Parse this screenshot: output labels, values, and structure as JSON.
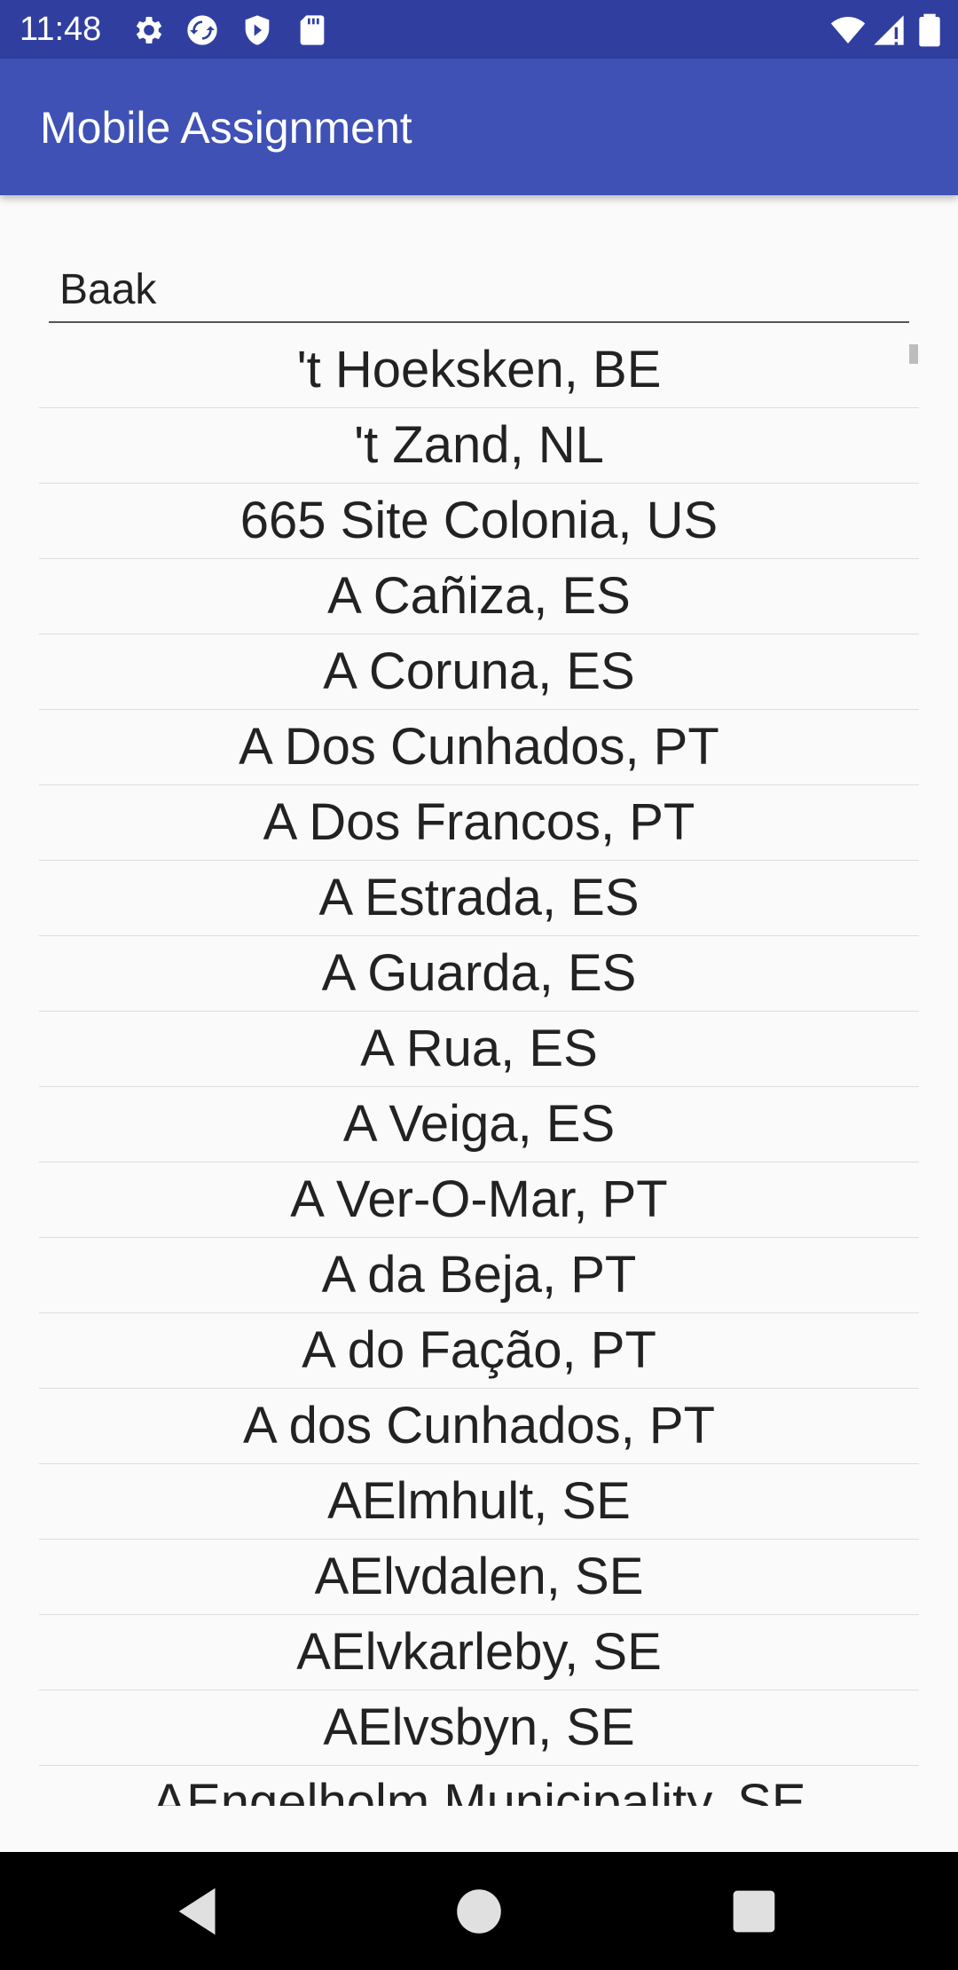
{
  "status_bar": {
    "time": "11:48",
    "icons": [
      "gear-icon",
      "sync-icon",
      "shield-icon",
      "sd-card-icon",
      "wifi-icon",
      "signal-icon",
      "battery-icon"
    ]
  },
  "app_bar": {
    "title": "Mobile Assignment",
    "color": "#3f51b5",
    "status_color": "#303f9f"
  },
  "search": {
    "value": "Baak"
  },
  "list": {
    "items": [
      "'t Hoeksken, BE",
      "'t Zand, NL",
      "665 Site Colonia, US",
      "A Cañiza, ES",
      "A Coruna, ES",
      "A Dos Cunhados, PT",
      "A Dos Francos, PT",
      "A Estrada, ES",
      "A Guarda, ES",
      "A Rua, ES",
      "A Veiga, ES",
      "A Ver-O-Mar, PT",
      "A da Beja, PT",
      "A do Fação, PT",
      "A dos Cunhados, PT",
      "AElmhult, SE",
      "AElvdalen, SE",
      "AElvkarleby, SE",
      "AElvsbyn, SE",
      "AEngelholm Municipality, SE"
    ]
  },
  "nav_bar": {
    "buttons": [
      "back-icon",
      "home-icon",
      "recents-icon"
    ]
  }
}
